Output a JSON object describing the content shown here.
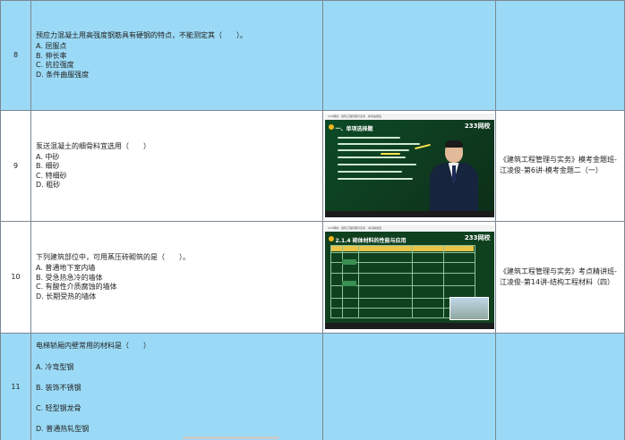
{
  "rows": [
    {
      "number": "8",
      "question": "预应力混凝土用高强度钢筋具有硬钢的特点，不能测定其（　　）。",
      "options": [
        "A. 屈服点",
        "B. 伸长率",
        "C. 抗拉强度",
        "D. 条件曲服强度"
      ],
      "source": ""
    },
    {
      "number": "9",
      "question": "泵送混凝土的细骨料宜选用（　　）",
      "options": [
        "A. 中砂",
        "B. 细砂",
        "C. 特细砂",
        "D. 粗砂"
      ],
      "source": "《建筑工程管理与实务》模考金题班-江凌俊-第6讲-模考金题二（一）",
      "thumbnail": {
        "headline": "一、单项选择题",
        "logo": "233网校",
        "toolbar": "233网校 · 建筑工程管理与实务 · 模考金题班"
      }
    },
    {
      "number": "10",
      "question": "下列建筑部位中，可用蒸压砖砌筑的是（　　）。",
      "options": [
        "A. 普通地下室内墙",
        "B. 受急热急冷的墙体",
        "C. 有酸性介质腐蚀的墙体",
        "D. 长期受热的墙体"
      ],
      "source": "《建筑工程管理与实务》考点精讲班-江凌俊-第14讲-结构工程材料（四）",
      "thumbnail": {
        "headline": "2.1.4 砌体材料的性能与应用",
        "logo": "233网校",
        "toolbar": "233网校 · 建筑工程管理与实务 · 考点精讲班"
      }
    },
    {
      "number": "11",
      "question": "电梯轿厢内壁常用的材料是（　　）",
      "options": [
        "A. 冷弯型钢",
        "B. 装饰不锈钢",
        "C. 轻型钢龙骨",
        "D. 普通热轧型钢"
      ],
      "source": ""
    }
  ],
  "colors": {
    "highlight_row": "#9bdaf6",
    "grid": "#7b8794"
  },
  "icons": [
    "play-video-icon",
    "brand-logo-icon"
  ]
}
